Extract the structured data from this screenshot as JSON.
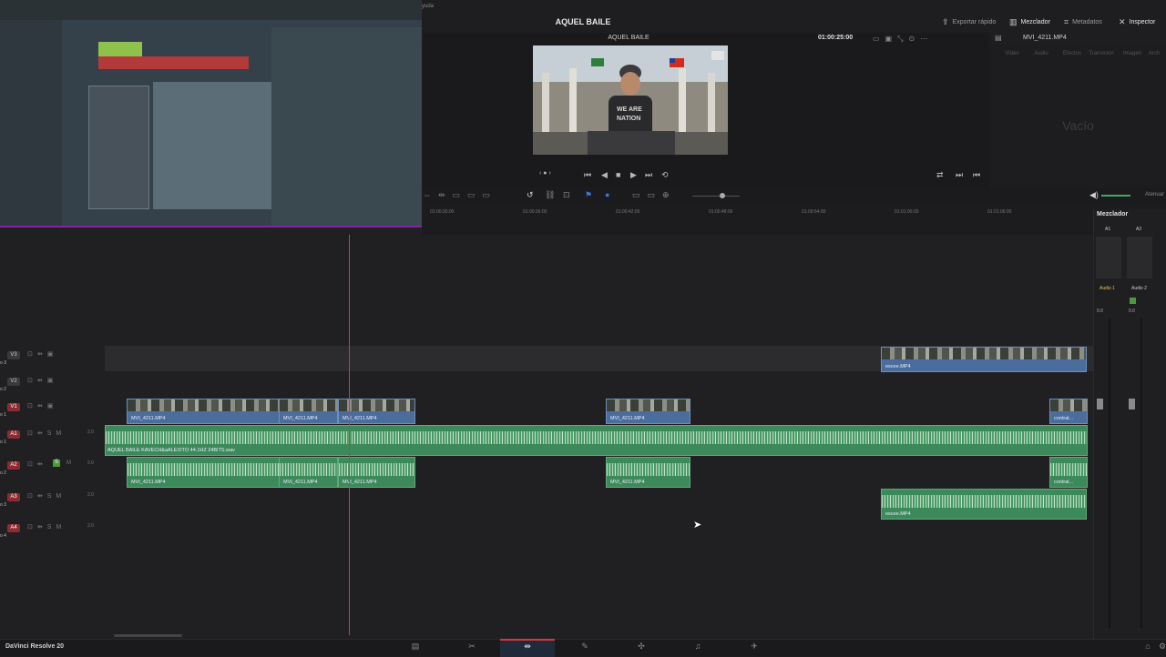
{
  "topbar": {
    "project_title": "AQUEL BAILE",
    "menu_fragment": "yuda",
    "buttons": [
      {
        "label": "Exportar rápido",
        "icon": "export-icon"
      },
      {
        "label": "Mezclador",
        "icon": "mixer-icon"
      },
      {
        "label": "Metadatos",
        "icon": "metadata-icon"
      },
      {
        "label": "Inspector",
        "icon": "inspector-icon"
      }
    ]
  },
  "viewer": {
    "timeline_name": "AQUEL BAILE",
    "timecode": "01:00:25:00",
    "clip_name": "MVI_4211.MP4"
  },
  "inspector": {
    "tabs": [
      "Video",
      "Audio",
      "Efectos",
      "Transición",
      "Imagen",
      "Arch"
    ],
    "empty_label": "Vacío"
  },
  "timeline": {
    "ruler": [
      "01:00:30:00",
      "01:00:36:00",
      "01:00:42:00",
      "01:00:48:00",
      "01:00:54:00",
      "01:01:00:00",
      "01:01:06:00"
    ],
    "tracks": [
      {
        "tag": "V3",
        "name": "o 3"
      },
      {
        "tag": "V2",
        "name": "o 2"
      },
      {
        "tag": "V1",
        "name": "o 1"
      },
      {
        "tag": "A1",
        "name": "o 1",
        "level": "2.0"
      },
      {
        "tag": "A2",
        "name": "o 2",
        "level": "2.0"
      },
      {
        "tag": "A3",
        "name": "o 3",
        "level": "2.0"
      },
      {
        "tag": "A4",
        "name": "o 4",
        "level": "2.0"
      }
    ],
    "video_clips": [
      {
        "label": "escee.MP4"
      },
      {
        "label": "MVI_4211.MP4"
      },
      {
        "label": "MVI_4211.MP4"
      },
      {
        "label": "MVI_4211.MP4"
      },
      {
        "label": "MVI_4211.MP4"
      },
      {
        "label": "contral..."
      }
    ],
    "audio_main_label": "AQUEL BAILE KAVECH&aALEXITO 44.1HZ 24BITS.wav",
    "audio_clips": [
      {
        "label": "MVI_4211.MP4"
      },
      {
        "label": "MVI_4211.MP4"
      },
      {
        "label": "MVI_4211.MP4"
      },
      {
        "label": "MVI_4211.MP4"
      },
      {
        "label": "contral..."
      },
      {
        "label": "escee.MP4"
      }
    ]
  },
  "toolbar": {
    "atenuar": "Atenuar"
  },
  "mixer": {
    "title": "Mezclador",
    "channels": [
      "A1",
      "A2"
    ],
    "buses": [
      "Audio 1",
      "Audio 2"
    ],
    "levels": [
      "0.0",
      "0.0"
    ]
  },
  "bottombar": {
    "app_name": "DaVinci Resolve 20"
  },
  "colors": {
    "accent": "#d23b3b",
    "video_clip": "#4a6d9c",
    "audio_clip": "#3c8a5a"
  }
}
